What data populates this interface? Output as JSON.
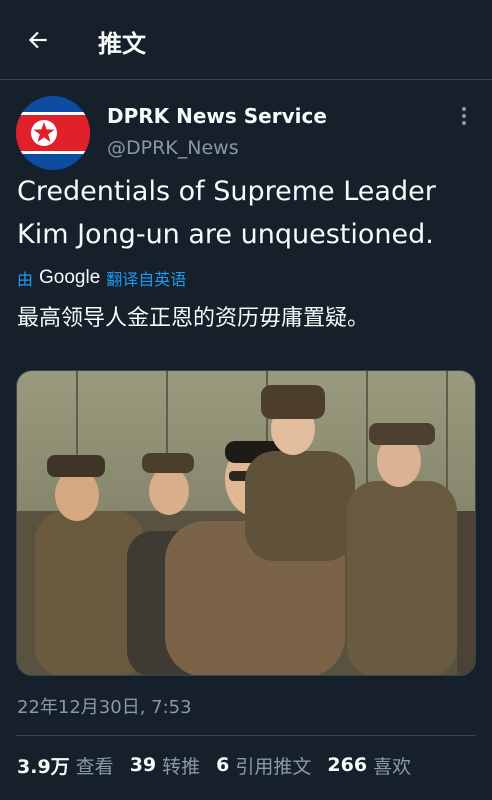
{
  "header": {
    "title": "推文"
  },
  "author": {
    "display_name": "DPRK News Service",
    "handle": "@DPRK_News"
  },
  "tweet": {
    "text": "Credentials of Supreme Leader Kim Jong-un are unquestioned.",
    "translation": {
      "prefix": "由",
      "provider": "Google",
      "suffix": "翻译自英语",
      "text": "最高领导人金正恩的资历毋庸置疑。"
    },
    "timestamp": "22年12月30日, 7:53"
  },
  "stats": [
    {
      "value": "3.9万",
      "label": "查看"
    },
    {
      "value": "39",
      "label": "转推"
    },
    {
      "value": "6",
      "label": "引用推文"
    },
    {
      "value": "266",
      "label": "喜欢"
    }
  ],
  "icons": {
    "back": "arrow-left-icon",
    "more": "more-vertical-icon",
    "avatar": "north-korea-flag"
  },
  "colors": {
    "background": "#15202b",
    "accent": "#1d9bf0",
    "secondary_text": "#8b98a5",
    "border": "#38444d"
  }
}
